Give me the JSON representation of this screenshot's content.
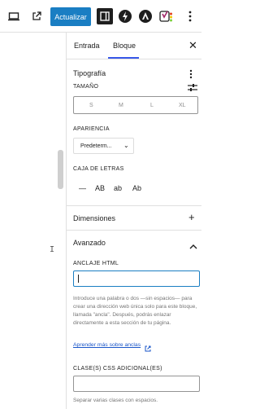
{
  "toolbar": {
    "update_label": "Actualizar",
    "icons": [
      "desktop-icon",
      "external-link-icon",
      "sidebar-toggle-icon",
      "lightning-icon",
      "astra-icon",
      "yoast-icon",
      "more-vertical-icon"
    ],
    "accent": "#1a7ec3"
  },
  "sidebar": {
    "tabs": [
      {
        "label": "Entrada"
      },
      {
        "label": "Bloque"
      }
    ],
    "typography": {
      "title": "Tipografía",
      "size_label": "TAMAÑO",
      "sizes": [
        "S",
        "M",
        "L",
        "XL"
      ],
      "appearance_label": "APARIENCIA",
      "appearance_value": "Predeterm...",
      "case_label": "CAJA DE LETRAS",
      "case_options": [
        "—",
        "AB",
        "ab",
        "Ab"
      ]
    },
    "dimensions": {
      "title": "Dimensiones",
      "expand_symbol": "+"
    },
    "advanced": {
      "title": "Avanzado",
      "anchor_label": "ANCLAJE HTML",
      "anchor_value": "",
      "help_text": "Introduce una palabra o dos —sin espacios— para crear una dirección web única solo para este bloque, llamada \"ancla\". Después, podrás enlazar directamente a esta sección de tu página.",
      "help_link": "Aprender más sobre anclas",
      "css_label": "CLASE(S) CSS ADICIONAL(ES)",
      "css_value": "",
      "css_help": "Separar varias clases con espacios."
    }
  }
}
